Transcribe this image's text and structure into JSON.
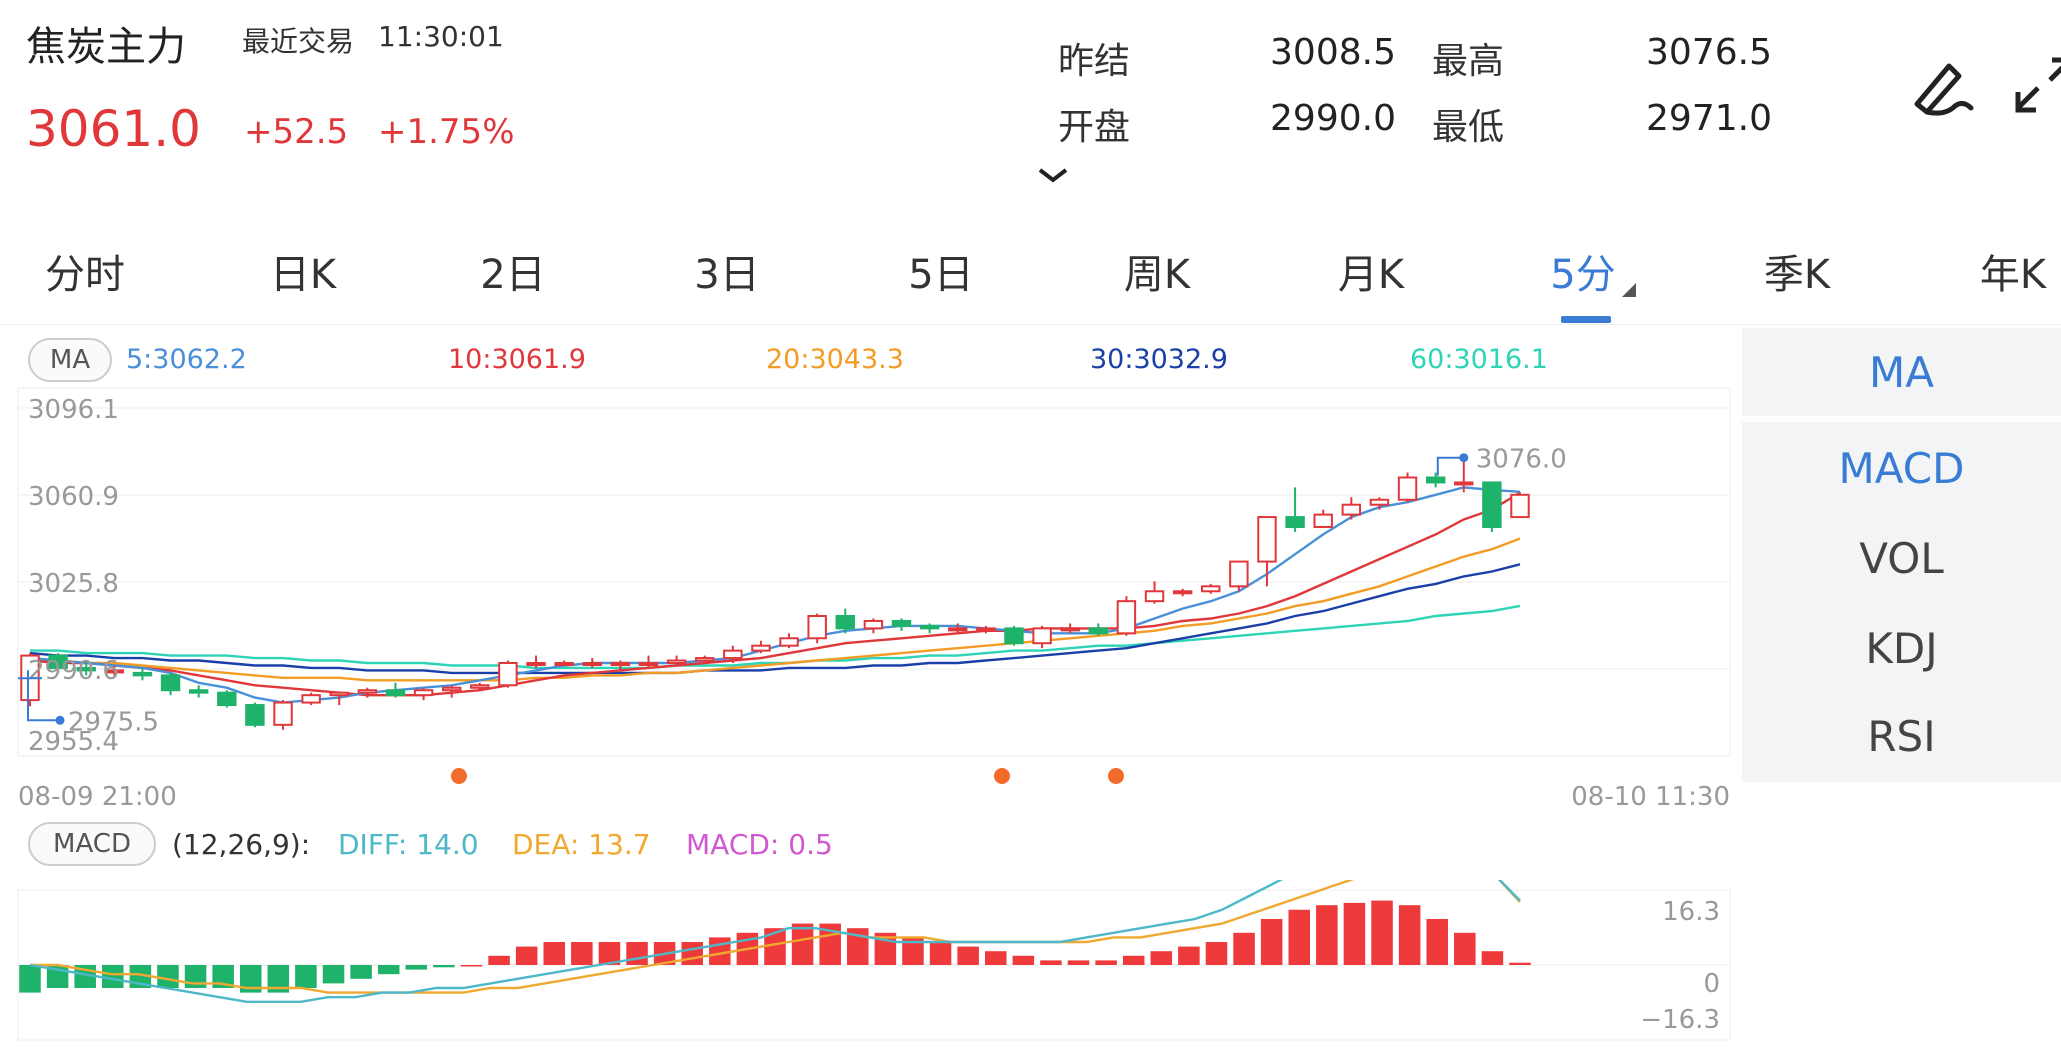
{
  "header": {
    "name": "焦炭主力",
    "trade_label": "最近交易",
    "trade_time": "11:30:01",
    "price": "3061.0",
    "change": "+52.5",
    "change_pct": "+1.75%",
    "quotes": [
      {
        "label": "昨结",
        "value": "3008.5"
      },
      {
        "label": "最高",
        "value": "3076.5"
      },
      {
        "label": "开盘",
        "value": "2990.0"
      },
      {
        "label": "最低",
        "value": "2971.0"
      }
    ]
  },
  "tabs": [
    "分时",
    "日K",
    "2日",
    "3日",
    "5日",
    "周K",
    "月K",
    "5分",
    "季K",
    "年K"
  ],
  "active_tab": "5分",
  "indicators": {
    "ma_label": "MA",
    "ma_values": [
      {
        "text": "5:3062.2",
        "color": "#4a90d9"
      },
      {
        "text": "10:3061.9",
        "color": "#e0373b"
      },
      {
        "text": "20:3043.3",
        "color": "#f39c25"
      },
      {
        "text": "30:3032.9",
        "color": "#1a3fa8"
      },
      {
        "text": "60:3016.1",
        "color": "#2dd4b6"
      }
    ],
    "macd_label": "MACD",
    "macd_params": "(12,26,9):",
    "diff": "DIFF: 14.0",
    "dea": "DEA: 13.7",
    "macd": "MACD: 0.5",
    "diff_color": "#4cb8c8",
    "dea_color": "#f0a830",
    "macd_color": "#d058d0"
  },
  "side_panel": {
    "top": "MA",
    "items": [
      "MACD",
      "VOL",
      "KDJ",
      "RSI"
    ]
  },
  "axis": {
    "price_ticks": [
      "3096.1",
      "3060.9",
      "3025.8",
      "2990.6",
      "2955.4"
    ],
    "time_start": "08-09 21:00",
    "time_end": "08-10 11:30",
    "high_label": "3076.0",
    "low_label": "2975.5",
    "macd_ticks": [
      "16.3",
      "0",
      "−16.3"
    ]
  },
  "colors": {
    "up": "#e0373b",
    "down": "#1fb26b",
    "accent": "#3a7bd5",
    "ma5": "#4a90d9",
    "ma10": "#e0373b",
    "ma20": "#f39c25",
    "ma30": "#1a3fa8",
    "ma60": "#2dd4b6"
  },
  "chart_data": {
    "type": "candlestick",
    "ylim": [
      2955.4,
      3096.1
    ],
    "candles": [
      [
        2978,
        2996,
        2975.5,
        2997
      ],
      [
        2996,
        2991,
        2989,
        2997
      ],
      [
        2991,
        2990,
        2988,
        2993
      ],
      [
        2990,
        2990,
        2988,
        2992
      ],
      [
        2989,
        2988,
        2986,
        2991
      ],
      [
        2988,
        2982,
        2980,
        2989
      ],
      [
        2982,
        2981,
        2979,
        2984
      ],
      [
        2981,
        2976,
        2975,
        2982
      ],
      [
        2976,
        2968,
        2967,
        2977
      ],
      [
        2968,
        2977,
        2966,
        2978
      ],
      [
        2977,
        2980,
        2976,
        2981
      ],
      [
        2980,
        2981,
        2976,
        2981
      ],
      [
        2981,
        2982,
        2979,
        2983
      ],
      [
        2982,
        2980,
        2979,
        2985
      ],
      [
        2980,
        2982,
        2978,
        2983
      ],
      [
        2982,
        2983,
        2979,
        2984
      ],
      [
        2983,
        2984,
        2982,
        2985
      ],
      [
        2984,
        2993,
        2983,
        2994
      ],
      [
        2993,
        2993,
        2991,
        2996
      ],
      [
        2993,
        2993,
        2992,
        2994
      ],
      [
        2993,
        2993,
        2991,
        2995
      ],
      [
        2993,
        2993,
        2990,
        2994
      ],
      [
        2993,
        2993,
        2991,
        2996
      ],
      [
        2993,
        2994,
        2992,
        2996
      ],
      [
        2994,
        2995,
        2993,
        2996
      ],
      [
        2995,
        2998,
        2993,
        3000
      ],
      [
        2998,
        3000,
        2997,
        3002
      ],
      [
        3000,
        3003,
        2999,
        3005
      ],
      [
        3003,
        3012,
        3001,
        3013
      ],
      [
        3012,
        3007,
        3005,
        3015
      ],
      [
        3007,
        3010,
        3005,
        3011
      ],
      [
        3010,
        3008,
        3006,
        3011
      ],
      [
        3008,
        3007,
        3005,
        3009
      ],
      [
        3007,
        3007,
        3005,
        3009
      ],
      [
        3007,
        3007,
        3005,
        3008
      ],
      [
        3007,
        3001,
        3000,
        3008
      ],
      [
        3001,
        3007,
        2999,
        3008
      ],
      [
        3007,
        3007,
        3005,
        3009
      ],
      [
        3007,
        3005,
        3004,
        3009
      ],
      [
        3005,
        3018,
        3004,
        3020
      ],
      [
        3018,
        3022,
        3017,
        3026
      ],
      [
        3022,
        3022,
        3020,
        3023
      ],
      [
        3022,
        3024,
        3021,
        3025
      ],
      [
        3024,
        3034,
        3022,
        3034
      ],
      [
        3034,
        3052,
        3024,
        3052
      ],
      [
        3052,
        3048,
        3046,
        3064
      ],
      [
        3048,
        3053,
        3048,
        3055
      ],
      [
        3053,
        3057,
        3051,
        3060
      ],
      [
        3057,
        3059,
        3055,
        3060
      ],
      [
        3059,
        3068,
        3058,
        3070
      ],
      [
        3068,
        3066,
        3064,
        3070
      ],
      [
        3066,
        3066,
        3062,
        3076
      ],
      [
        3066,
        3048,
        3046,
        3066
      ],
      [
        3052,
        3061,
        3052,
        3062
      ]
    ],
    "ma5": [
      2995,
      2994,
      2993,
      2992,
      2991,
      2989,
      2985,
      2983,
      2979,
      2977,
      2978,
      2979,
      2981,
      2982,
      2983,
      2984,
      2986,
      2988,
      2990,
      2992,
      2993,
      2993,
      2993,
      2993,
      2994,
      2995,
      2998,
      3001,
      3004,
      3006,
      3007,
      3008,
      3008,
      3008,
      3007,
      3006,
      3005,
      3005,
      3005,
      3007,
      3011,
      3015,
      3018,
      3022,
      3029,
      3037,
      3045,
      3052,
      3056,
      3058,
      3061,
      3064,
      3063,
      3062.2
    ],
    "ma10": [
      2994,
      2993,
      2993,
      2992,
      2991,
      2990,
      2988,
      2986,
      2984,
      2983,
      2982,
      2981,
      2980,
      2980,
      2980,
      2981,
      2982,
      2984,
      2986,
      2988,
      2989,
      2990,
      2991,
      2992,
      2993,
      2994,
      2995,
      2997,
      2999,
      3001,
      3002,
      3003,
      3004,
      3005,
      3006,
      3006,
      3007,
      3007,
      3007,
      3007,
      3008,
      3010,
      3011,
      3013,
      3016,
      3020,
      3025,
      3030,
      3035,
      3040,
      3045,
      3051,
      3055,
      3061.9
    ],
    "ma20": [
      2994,
      2994,
      2993,
      2993,
      2992,
      2991,
      2990,
      2989,
      2988,
      2987,
      2987,
      2987,
      2986,
      2986,
      2986,
      2986,
      2986,
      2986,
      2987,
      2987,
      2988,
      2988,
      2989,
      2989,
      2990,
      2991,
      2992,
      2993,
      2994,
      2995,
      2996,
      2997,
      2998,
      2999,
      3000,
      3001,
      3002,
      3003,
      3004,
      3005,
      3006,
      3008,
      3009,
      3011,
      3013,
      3016,
      3018,
      3021,
      3024,
      3028,
      3032,
      3036,
      3039,
      3043.3
    ],
    "ma30": [
      2997,
      2996,
      2996,
      2995,
      2995,
      2994,
      2994,
      2993,
      2992,
      2992,
      2991,
      2991,
      2990,
      2990,
      2990,
      2989,
      2989,
      2989,
      2989,
      2989,
      2989,
      2989,
      2989,
      2989,
      2990,
      2990,
      2990,
      2991,
      2991,
      2991,
      2992,
      2992,
      2993,
      2993,
      2994,
      2995,
      2996,
      2997,
      2998,
      2999,
      3001,
      3003,
      3005,
      3007,
      3009,
      3012,
      3014,
      3017,
      3020,
      3023,
      3025,
      3028,
      3030,
      3032.9
    ],
    "ma60": [
      2998,
      2998,
      2997,
      2997,
      2997,
      2996,
      2996,
      2996,
      2995,
      2995,
      2994,
      2994,
      2993,
      2993,
      2993,
      2992,
      2992,
      2992,
      2991,
      2991,
      2991,
      2991,
      2991,
      2992,
      2992,
      2992,
      2993,
      2993,
      2994,
      2994,
      2995,
      2995,
      2996,
      2996,
      2997,
      2998,
      2998,
      2999,
      3000,
      3000,
      3001,
      3002,
      3003,
      3004,
      3005,
      3006,
      3007,
      3008,
      3009,
      3010,
      3012,
      3013,
      3014,
      3016.1
    ],
    "macd_hist": [
      -6,
      -5,
      -5,
      -5,
      -5,
      -5,
      -5,
      -5,
      -6,
      -6,
      -5,
      -4,
      -3,
      -2,
      -1,
      -0.5,
      0,
      2,
      4,
      5,
      5,
      5,
      5,
      5,
      5,
      6,
      7,
      8,
      9,
      9,
      8,
      7,
      6,
      5,
      4,
      3,
      2,
      1,
      1,
      1,
      2,
      3,
      4,
      5,
      7,
      10,
      12,
      13,
      13.5,
      14,
      13,
      10,
      7,
      3,
      0.5
    ],
    "diff": [
      0,
      -1,
      -2,
      -3,
      -4,
      -5,
      -6,
      -7,
      -8,
      -8,
      -8,
      -7,
      -7,
      -6,
      -6,
      -5,
      -5,
      -4,
      -3,
      -2,
      -1,
      0,
      1,
      2,
      3,
      4,
      5,
      6,
      8,
      8,
      7,
      6,
      5,
      5,
      5,
      5,
      5,
      5,
      5,
      6,
      7,
      8,
      9,
      10,
      12,
      15,
      18,
      21,
      24,
      26,
      27,
      27,
      24,
      22,
      20,
      14.0
    ],
    "dea": [
      0,
      0,
      -1,
      -2,
      -2,
      -3,
      -4,
      -4,
      -5,
      -5,
      -5,
      -6,
      -6,
      -6,
      -6,
      -6,
      -6,
      -5,
      -5,
      -4,
      -3,
      -2,
      -1,
      0,
      1,
      2,
      3,
      4,
      5,
      6,
      7,
      6,
      6,
      6,
      5,
      5,
      5,
      5,
      5,
      5,
      6,
      6,
      7,
      8,
      9,
      11,
      13,
      15,
      17,
      19,
      20,
      21,
      22,
      22,
      20,
      13.7
    ],
    "macd_ylim": [
      -16.3,
      16.3
    ]
  }
}
